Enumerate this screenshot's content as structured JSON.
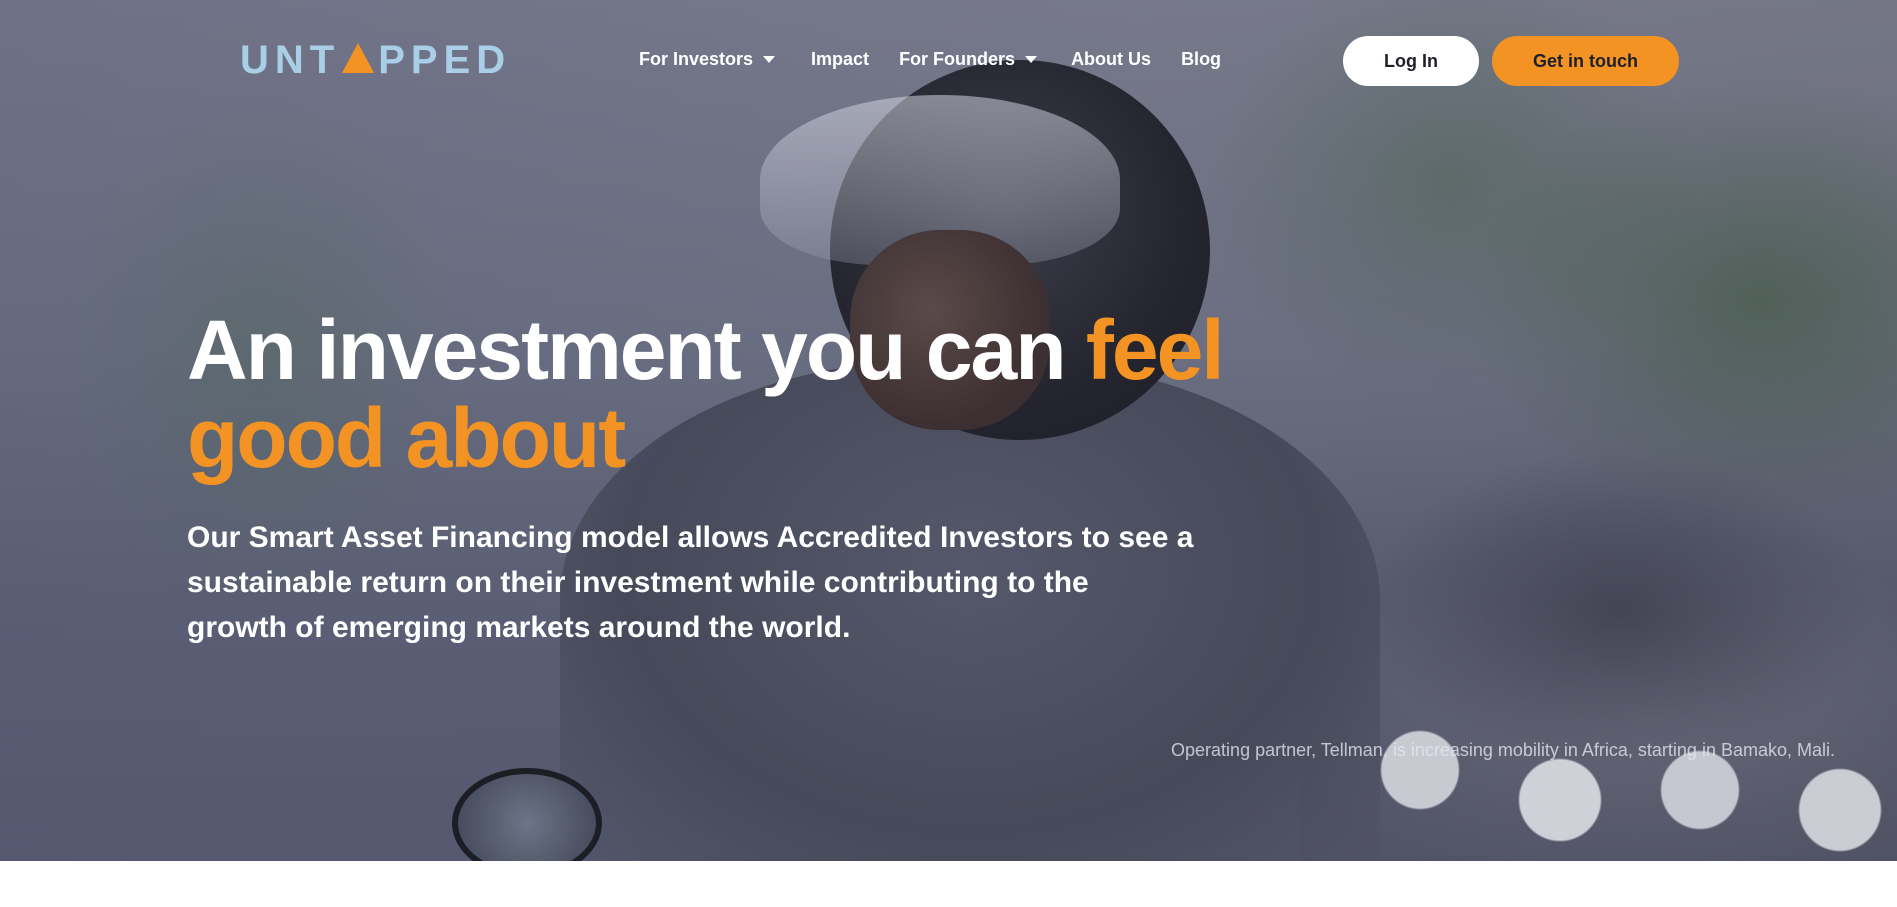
{
  "brand": {
    "logo_left": "UNT",
    "logo_right": "PPED",
    "logo_accent": "#f39323",
    "logo_color": "#a8cfe6"
  },
  "nav": {
    "items": [
      {
        "label": "For Investors",
        "dropdown": true
      },
      {
        "label": "Impact",
        "dropdown": false
      },
      {
        "label": "For Founders",
        "dropdown": true
      },
      {
        "label": "About Us",
        "dropdown": false
      },
      {
        "label": "Blog",
        "dropdown": false
      }
    ]
  },
  "header": {
    "login_label": "Log In",
    "contact_label": "Get in touch"
  },
  "hero": {
    "headline_main": "An investment you can ",
    "headline_accent_1": "feel",
    "headline_accent_2": "good about",
    "subtext": "Our Smart Asset Financing model allows Accredited Investors to see a sustainable return on their investment while contributing to the growth of emerging markets around the world.",
    "caption": "Operating partner, Tellman, is increasing mobility in Africa, starting in Bamako, Mali."
  },
  "colors": {
    "accent": "#f39323",
    "button_light": "#ffffff",
    "text_dark": "#1e1f2a"
  }
}
